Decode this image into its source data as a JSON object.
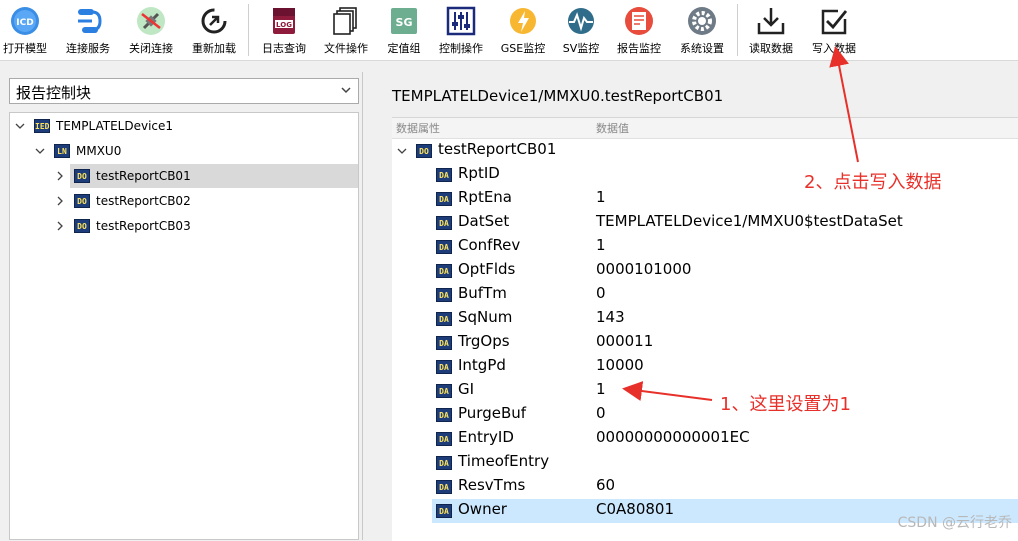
{
  "toolbar": {
    "buttons": [
      {
        "label": "打开模型",
        "icon": "icd-icon"
      },
      {
        "label": "连接服务",
        "icon": "connect-icon"
      },
      {
        "label": "关闭连接",
        "icon": "disconnect-icon"
      },
      {
        "label": "重新加载",
        "icon": "reload-icon"
      },
      {
        "label": "日志查询",
        "icon": "log-icon",
        "icon_text": "LOG"
      },
      {
        "label": "文件操作",
        "icon": "file-icon"
      },
      {
        "label": "定值组",
        "icon": "sg-icon",
        "icon_text": "SG"
      },
      {
        "label": "控制操作",
        "icon": "control-icon"
      },
      {
        "label": "GSE监控",
        "icon": "gse-icon"
      },
      {
        "label": "SV监控",
        "icon": "sv-icon"
      },
      {
        "label": "报告监控",
        "icon": "report-icon"
      },
      {
        "label": "系统设置",
        "icon": "settings-icon"
      },
      {
        "label": "读取数据",
        "icon": "read-data-icon"
      },
      {
        "label": "写入数据",
        "icon": "write-data-icon"
      }
    ],
    "icd_text": "ICD"
  },
  "left": {
    "combo_value": "报告控制块",
    "tree": [
      {
        "label": "TEMPLATELDevice1",
        "badge": "IED"
      },
      {
        "label": "MMXU0",
        "badge": "LN"
      },
      {
        "label": "testReportCB01",
        "badge": "DO",
        "selected": true
      },
      {
        "label": "testReportCB02",
        "badge": "DO"
      },
      {
        "label": "testReportCB03",
        "badge": "DO"
      }
    ]
  },
  "right": {
    "title": "TEMPLATELDevice1/MMXU0.testReportCB01",
    "col_attr": "数据属性",
    "col_value": "数据值",
    "root": {
      "label": "testReportCB01",
      "badge": "DO"
    },
    "rows": [
      {
        "name": "RptID",
        "value": ""
      },
      {
        "name": "RptEna",
        "value": "1"
      },
      {
        "name": "DatSet",
        "value": "TEMPLATELDevice1/MMXU0$testDataSet"
      },
      {
        "name": "ConfRev",
        "value": "1"
      },
      {
        "name": "OptFlds",
        "value": "0000101000"
      },
      {
        "name": "BufTm",
        "value": "0"
      },
      {
        "name": "SqNum",
        "value": "143"
      },
      {
        "name": "TrgOps",
        "value": "000011"
      },
      {
        "name": "IntgPd",
        "value": "10000"
      },
      {
        "name": "GI",
        "value": "1"
      },
      {
        "name": "PurgeBuf",
        "value": "0"
      },
      {
        "name": "EntryID",
        "value": "00000000000001EC"
      },
      {
        "name": "TimeofEntry",
        "value": ""
      },
      {
        "name": "ResvTms",
        "value": "60"
      },
      {
        "name": "Owner",
        "value": "C0A80801",
        "highlighted": true
      }
    ],
    "da_badge": "DA"
  },
  "annotations": {
    "step1": "1、这里设置为1",
    "step2": "2、点击写入数据",
    "color": "#e8302a"
  },
  "watermark": "CSDN @云行老乔"
}
